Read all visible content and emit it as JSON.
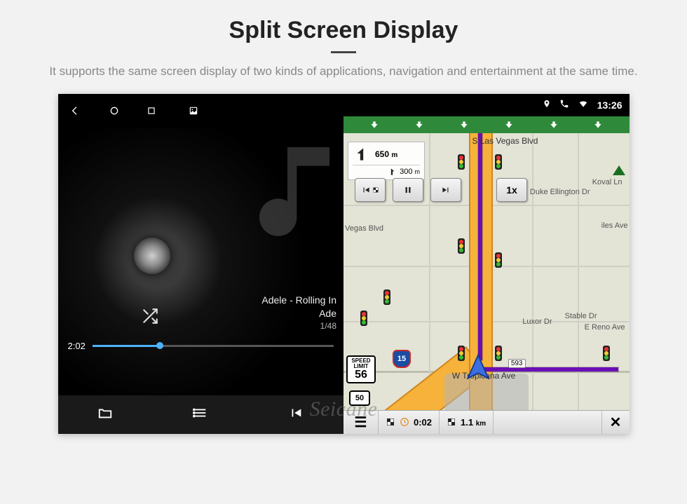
{
  "header": {
    "title": "Split Screen Display",
    "subtitle": "It supports the same screen display of two kinds of applications, navigation and entertainment at the same time."
  },
  "player": {
    "track_title": "Adele - Rolling In",
    "track_artist": "Ade",
    "track_index": "1/48",
    "elapsed": "2:02"
  },
  "statusbar": {
    "time": "13:26"
  },
  "nav": {
    "turn_distance": "650",
    "turn_unit": "m",
    "next_turn_distance": "300",
    "next_turn_unit": "m",
    "speed_label": "SPEED LIMIT",
    "speed_value": "56",
    "route_shield": "50",
    "freeway_number": "15",
    "playback_speed": "1x",
    "eta_time": "0:02",
    "eta_dist": "1.1",
    "eta_dist_unit": "km",
    "street_top": "S Las Vegas Blvd",
    "street_bottom": "W Tropicana Ave",
    "poi_duke": "Duke Ellington Dr",
    "poi_koval": "Koval Ln",
    "poi_iles": "iles Ave",
    "poi_luxor": "Luxor Dr",
    "poi_reno": "E Reno Ave",
    "poi_stable": "Stable Dr",
    "poi_vegas": "Vegas Blvd",
    "pin_593": "593"
  },
  "watermark": "Seicane"
}
